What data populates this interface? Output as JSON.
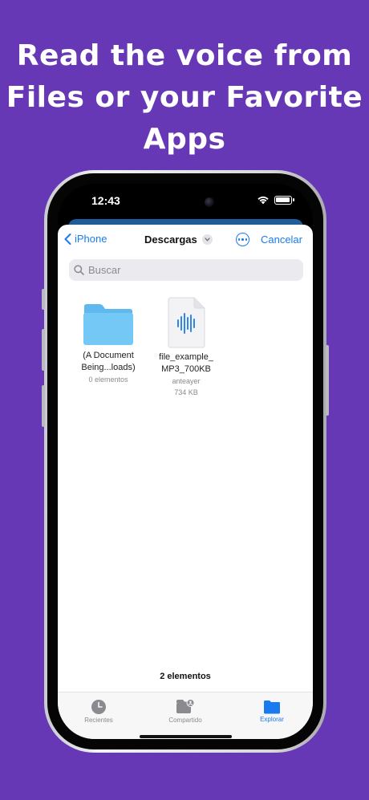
{
  "headline": {
    "line1": "Read the voice from",
    "line2": "Files or your Favorite",
    "line3": "Apps"
  },
  "status": {
    "time": "12:43"
  },
  "nav": {
    "back_label": "iPhone",
    "title": "Descargas",
    "cancel_label": "Cancelar"
  },
  "search": {
    "placeholder": "Buscar"
  },
  "items": [
    {
      "name_line1": "(A Document",
      "name_line2": "Being...loads)",
      "meta": "0 elementos",
      "icon": "folder-icon"
    },
    {
      "name_line1": "file_example_",
      "name_line2": "MP3_700KB",
      "meta": "anteayer",
      "size": "734 KB",
      "icon": "audio-file-icon"
    }
  ],
  "summary": {
    "count_label": "2 elementos"
  },
  "tabs": [
    {
      "label": "Recientes",
      "icon": "clock-icon",
      "active": false
    },
    {
      "label": "Compartido",
      "icon": "shared-folder-icon",
      "active": false
    },
    {
      "label": "Explorar",
      "icon": "folder-icon",
      "active": true
    }
  ],
  "colors": {
    "background": "#6638b5",
    "accent": "#1a7bf0",
    "folder": "#72c6f5"
  }
}
